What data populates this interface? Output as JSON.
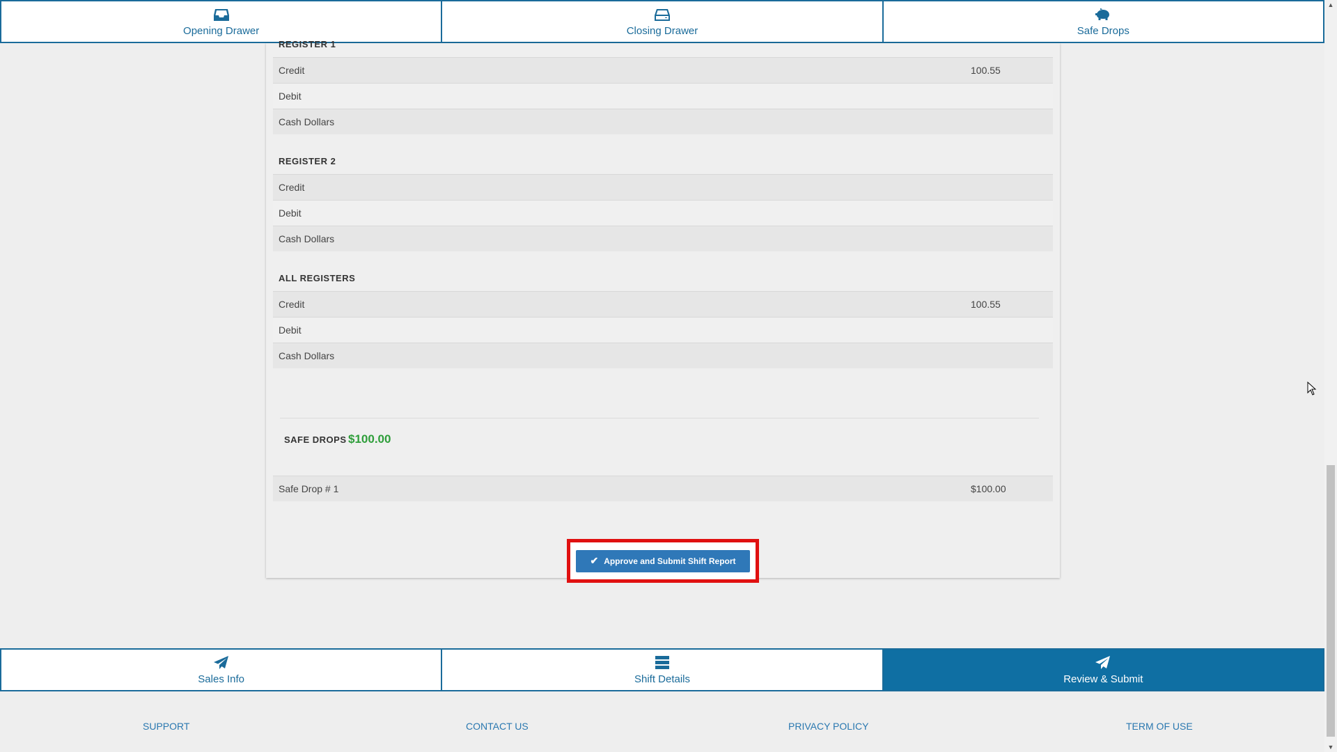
{
  "top_tabs": [
    {
      "label": "Opening Drawer",
      "icon": "inbox-icon"
    },
    {
      "label": "Closing Drawer",
      "icon": "drawer-icon"
    },
    {
      "label": "Safe Drops",
      "icon": "piggy-bank-icon"
    }
  ],
  "register1": {
    "title": "REGISTER 1",
    "rows": [
      {
        "label": "Credit",
        "value": "100.55"
      },
      {
        "label": "Debit",
        "value": ""
      },
      {
        "label": "Cash Dollars",
        "value": ""
      }
    ]
  },
  "register2": {
    "title": "REGISTER 2",
    "rows": [
      {
        "label": "Credit",
        "value": ""
      },
      {
        "label": "Debit",
        "value": ""
      },
      {
        "label": "Cash Dollars",
        "value": ""
      }
    ]
  },
  "all_registers": {
    "title": "ALL REGISTERS",
    "rows": [
      {
        "label": "Credit",
        "value": "100.55"
      },
      {
        "label": "Debit",
        "value": ""
      },
      {
        "label": "Cash Dollars",
        "value": ""
      }
    ]
  },
  "safe_drops": {
    "label": "SAFE DROPS",
    "total": "$100.00",
    "items": [
      {
        "label": "Safe Drop # 1",
        "value": "$100.00"
      }
    ]
  },
  "submit_button": {
    "label": "Approve and Submit Shift Report"
  },
  "bottom_tabs": [
    {
      "label": "Sales Info",
      "icon": "paper-plane-icon",
      "active": false
    },
    {
      "label": "Shift Details",
      "icon": "list-icon",
      "active": false
    },
    {
      "label": "Review & Submit",
      "icon": "paper-plane-icon",
      "active": true
    }
  ],
  "footer": {
    "support": "SUPPORT",
    "contact": "CONTACT US",
    "privacy": "PRIVACY POLICY",
    "terms": "TERM OF USE"
  },
  "colors": {
    "accent": "#1a6b9a",
    "active_tab": "#0f6fa3",
    "safe_amount": "#2e9e3a",
    "highlight": "#e01010"
  }
}
